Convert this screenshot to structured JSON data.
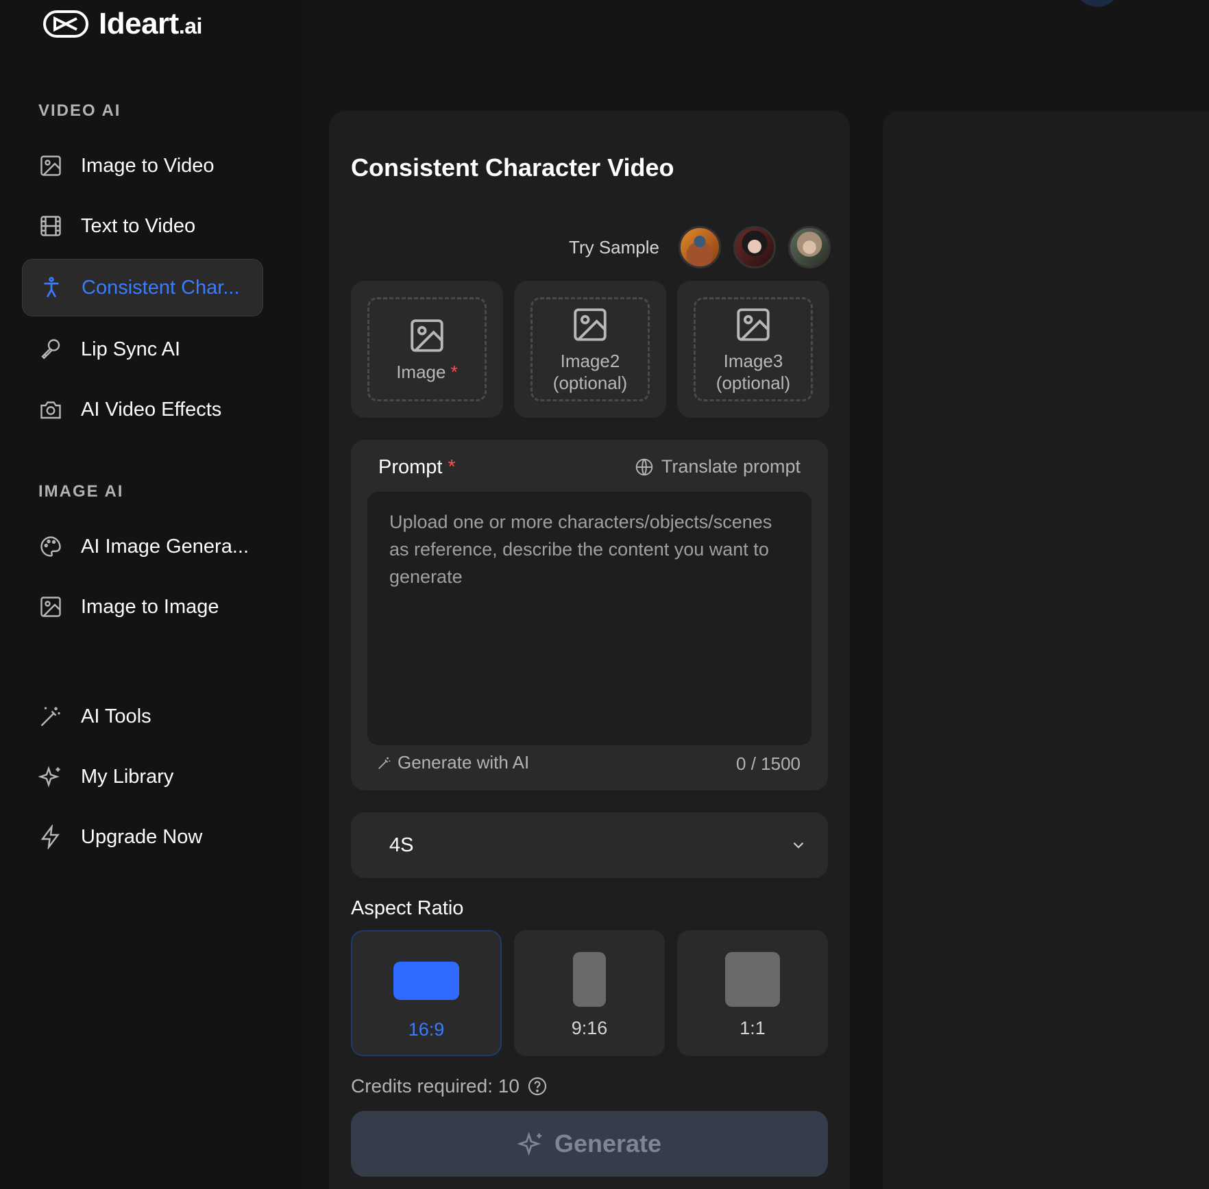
{
  "brand": {
    "name": "Ideart",
    "suffix": ".ai"
  },
  "sidebar": {
    "video_section": "VIDEO AI",
    "video_items": [
      {
        "label": "Image to Video",
        "icon": "image-icon"
      },
      {
        "label": "Text to Video",
        "icon": "film-icon"
      },
      {
        "label": "Consistent Char...",
        "icon": "person-icon",
        "active": true
      },
      {
        "label": "Lip Sync AI",
        "icon": "microphone-icon"
      },
      {
        "label": "AI Video Effects",
        "icon": "camera-icon"
      }
    ],
    "image_section": "IMAGE AI",
    "image_items": [
      {
        "label": "AI Image Genera...",
        "icon": "palette-icon"
      },
      {
        "label": "Image to Image",
        "icon": "image-icon"
      }
    ],
    "other_items": [
      {
        "label": "AI Tools",
        "icon": "magic-wand-icon"
      },
      {
        "label": "My Library",
        "icon": "sparkle-icon"
      },
      {
        "label": "Upgrade Now",
        "icon": "lightning-icon"
      }
    ]
  },
  "main": {
    "title": "Consistent Character Video",
    "try_sample": "Try Sample",
    "uploads": [
      {
        "label": "Image",
        "required": "*"
      },
      {
        "label": "Image2 (optional)"
      },
      {
        "label": "Image3 (optional)"
      }
    ],
    "prompt": {
      "label": "Prompt",
      "required": "*",
      "translate": "Translate prompt",
      "placeholder": "Upload one or more characters/objects/scenes as reference, describe the content you want to generate",
      "value": "",
      "generate_ai": "Generate with AI",
      "counter": "0 / 1500"
    },
    "duration": {
      "value": "4S"
    },
    "aspect": {
      "label": "Aspect Ratio",
      "options": [
        {
          "label": "16:9",
          "selected": true
        },
        {
          "label": "9:16",
          "selected": false
        },
        {
          "label": "1:1",
          "selected": false
        }
      ]
    },
    "credits": "Credits required: 10",
    "generate": "Generate"
  },
  "colors": {
    "accent": "#3b7bff",
    "background": "#151515",
    "panel": "#1e1e1e",
    "card": "#2a2a2a",
    "required": "#ff4d4f"
  }
}
